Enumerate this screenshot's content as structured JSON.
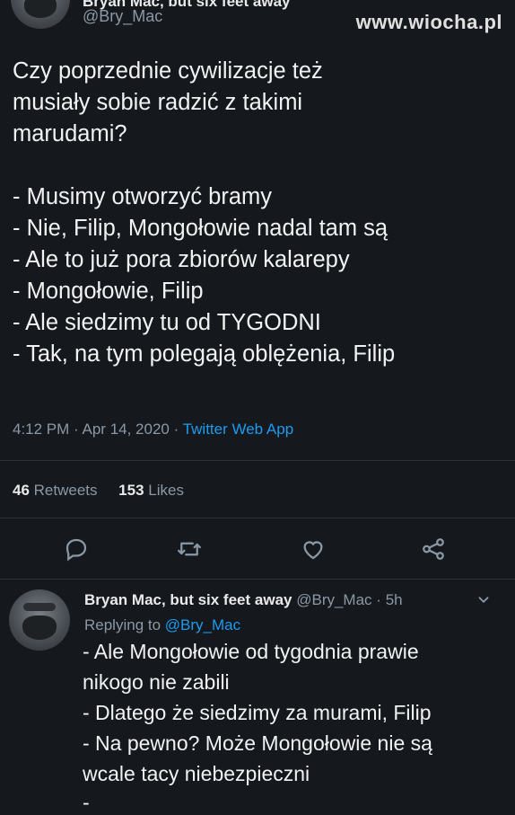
{
  "watermark": "www.wiocha.pl",
  "main_tweet": {
    "author_name_cut": "Bryan Mac, but six feet away",
    "handle": "@Bry_Mac",
    "text": "Czy poprzednie cywilizacje też\nmusiały sobie radzić z takimi\nmarudami?\n\n- Musimy otworzyć bramy\n- Nie, Filip, Mongołowie nadal tam są\n- Ale to już pora zbiorów kalarepy\n- Mongołowie, Filip\n- Ale siedzimy tu od TYGODNI\n- Tak, na tym polegają oblężenia, Filip",
    "time": "4:12 PM",
    "date": "Apr 14, 2020",
    "separator": "·",
    "source": "Twitter Web App",
    "retweets_count": "46",
    "retweets_label": "Retweets",
    "likes_count": "153",
    "likes_label": "Likes",
    "actions": {
      "reply_icon": "reply-icon",
      "retweet_icon": "retweet-icon",
      "like_icon": "heart-icon",
      "share_icon": "share-icon"
    }
  },
  "reply_tweet": {
    "author_name": "Bryan Mac, but six feet away",
    "handle": "@Bry_Mac",
    "separator": "·",
    "age": "5h",
    "replying_label": "Replying to",
    "replying_to": "@Bry_Mac",
    "text": "- Ale Mongołowie od tygodnia prawie\nnikogo nie zabili\n- Dlatego że siedzimy za murami, Filip\n- Na pewno? Może Mongołowie nie są\nwcale tacy niebezpieczni",
    "trailing": "-"
  },
  "colors": {
    "background": "#15181c",
    "link": "#1d9bf0",
    "muted": "#8b98a5",
    "divider": "#2f3336"
  }
}
